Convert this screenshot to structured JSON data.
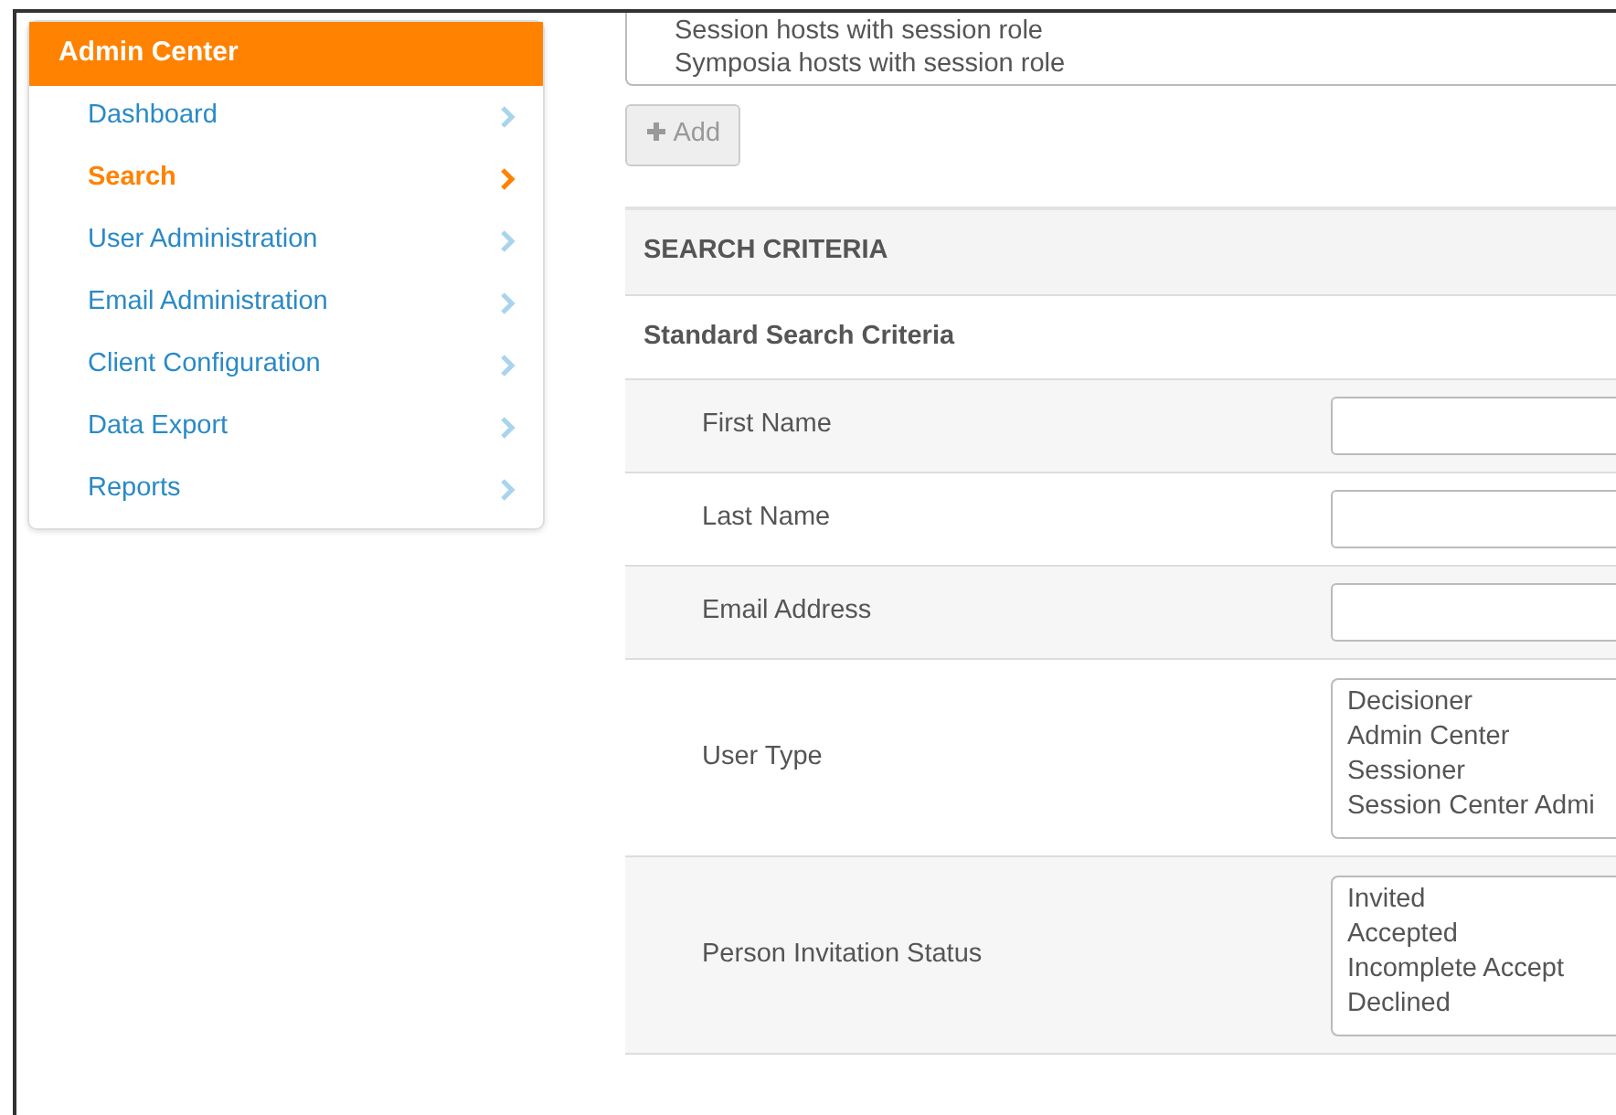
{
  "sidebar": {
    "title": "Admin Center",
    "items": [
      {
        "label": "Dashboard",
        "selected": false
      },
      {
        "label": "Search",
        "selected": true
      },
      {
        "label": "User Administration",
        "selected": false
      },
      {
        "label": "Email Administration",
        "selected": false
      },
      {
        "label": "Client Configuration",
        "selected": false
      },
      {
        "label": "Data Export",
        "selected": false
      },
      {
        "label": "Reports",
        "selected": false
      }
    ]
  },
  "role_list": {
    "options": [
      "Session hosts with session role",
      "Symposia hosts with session role"
    ]
  },
  "add_button": {
    "label": "Add",
    "disabled": true
  },
  "panel": {
    "title": "SEARCH CRITERIA",
    "subtitle": "Standard Search Criteria",
    "fields": [
      {
        "kind": "text",
        "label": "First Name"
      },
      {
        "kind": "text",
        "label": "Last Name"
      },
      {
        "kind": "text",
        "label": "Email Address"
      },
      {
        "kind": "list",
        "label": "User Type",
        "options": [
          "Decisioner",
          "Admin Center",
          "Sessioner",
          "Session Center Admi"
        ]
      },
      {
        "kind": "list",
        "label": "Person Invitation Status",
        "options": [
          "Invited",
          "Accepted",
          "Incomplete Accept",
          "Declined"
        ]
      }
    ]
  }
}
